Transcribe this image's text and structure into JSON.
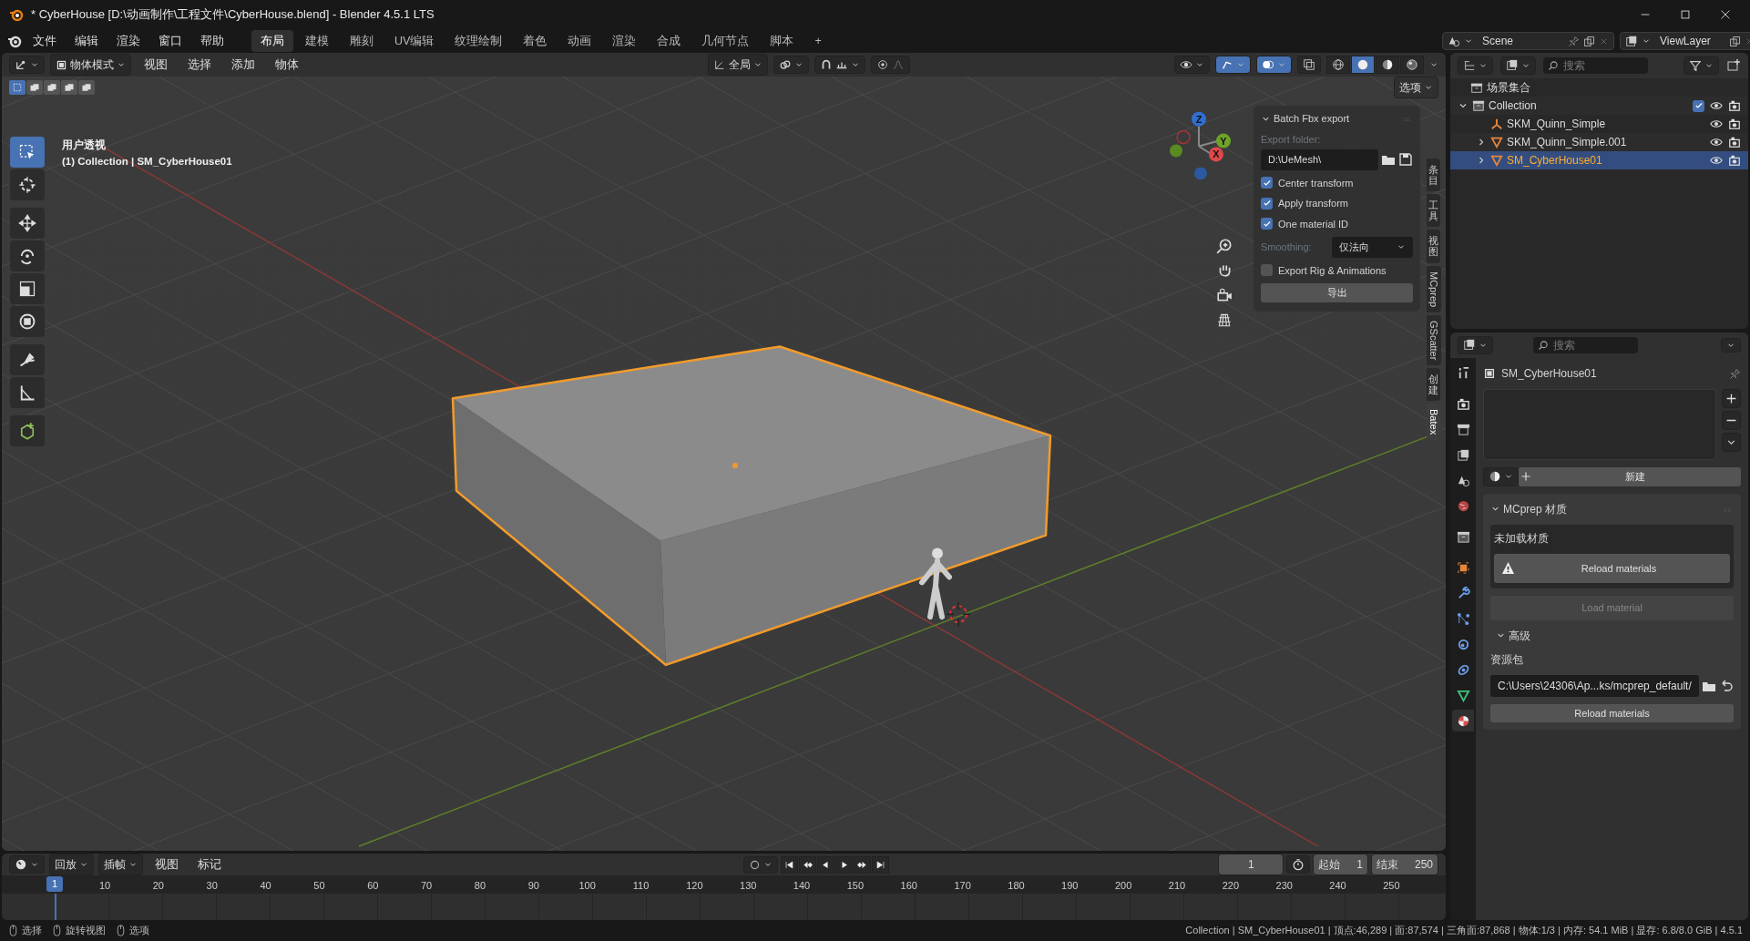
{
  "window": {
    "title": "* CyberHouse [D:\\动画制作\\工程文件\\CyberHouse.blend] - Blender 4.5.1 LTS"
  },
  "menu": [
    "文件",
    "编辑",
    "渲染",
    "窗口",
    "帮助"
  ],
  "workspaces": [
    {
      "label": "布局",
      "selected": true
    },
    {
      "label": "建模",
      "selected": false
    },
    {
      "label": "雕刻",
      "selected": false
    },
    {
      "label": "UV编辑",
      "selected": false
    },
    {
      "label": "纹理绘制",
      "selected": false
    },
    {
      "label": "着色",
      "selected": false
    },
    {
      "label": "动画",
      "selected": false
    },
    {
      "label": "渲染",
      "selected": false
    },
    {
      "label": "合成",
      "selected": false
    },
    {
      "label": "几何节点",
      "selected": false
    },
    {
      "label": "脚本",
      "selected": false
    }
  ],
  "add_workspace": "+",
  "scene": "Scene",
  "view_layer": "ViewLayer",
  "viewport": {
    "mode": "物体模式",
    "menus": [
      "视图",
      "选择",
      "添加",
      "物体"
    ],
    "orientation": "全局",
    "options": "选项",
    "view_name": "用户透视",
    "context": "(1) Collection | SM_CyberHouse01",
    "select_modes": [
      {
        "selected": true
      },
      {
        "selected": false
      },
      {
        "selected": false
      },
      {
        "selected": false
      },
      {
        "selected": false
      }
    ],
    "toggles": [
      {
        "kind": "visibility",
        "on": false
      },
      {
        "kind": "gizmo",
        "on": true
      },
      {
        "kind": "overlay",
        "on": true
      },
      {
        "kind": "xray",
        "on": false
      }
    ],
    "shading": [
      {
        "kind": "wireframe",
        "selected": false
      },
      {
        "kind": "solid",
        "selected": true
      },
      {
        "kind": "material",
        "selected": false
      },
      {
        "kind": "rendered",
        "selected": false
      }
    ],
    "tools": [
      {
        "kind": "select",
        "selected": true
      },
      {
        "kind": "cursor",
        "selected": false
      },
      {
        "kind": "move",
        "selected": false
      },
      {
        "kind": "rotate",
        "selected": false
      },
      {
        "kind": "scale",
        "selected": false
      },
      {
        "kind": "transform",
        "selected": false
      },
      {
        "kind": "annotate",
        "selected": false
      },
      {
        "kind": "measure",
        "selected": false
      },
      {
        "kind": "add",
        "selected": false
      }
    ],
    "gizmo": [
      "Z",
      "Y",
      "X"
    ]
  },
  "sidebar": {
    "title": "Batch Fbx export",
    "folder_label": "Export folder:",
    "folder": "D:\\UeMesh\\",
    "rows": [
      {
        "kind": "checkbox",
        "label": "Center transform",
        "checked": true
      },
      {
        "kind": "checkbox",
        "label": "Apply transform",
        "checked": true
      },
      {
        "kind": "checkbox",
        "label": "One material ID",
        "checked": true
      },
      {
        "kind": "select",
        "label": "Smoothing:",
        "value": "仅法向"
      },
      {
        "kind": "checkbox",
        "label": "Export Rig & Animations",
        "checked": false
      }
    ],
    "export_button": "导出",
    "tabs": [
      {
        "label": "条目",
        "kind": "stacked",
        "selected": false
      },
      {
        "label": "工具",
        "kind": "stacked",
        "selected": false
      },
      {
        "label": "视图",
        "kind": "stacked",
        "selected": false
      },
      {
        "label": "MCprep",
        "kind": "rotated",
        "selected": false
      },
      {
        "label": "GScatter",
        "kind": "rotated",
        "selected": false
      },
      {
        "label": "创建",
        "kind": "stacked",
        "selected": false
      },
      {
        "label": "Batex",
        "kind": "rotated",
        "selected": true
      }
    ]
  },
  "outliner": {
    "search_placeholder": "搜索",
    "root": "场景集合",
    "tree": [
      {
        "label": "Collection",
        "kind": "collection",
        "expanded": true,
        "checked": true,
        "selected": false,
        "children": [
          {
            "label": "SKM_Quinn_Simple",
            "kind": "armature",
            "selected": false
          },
          {
            "label": "SKM_Quinn_Simple.001",
            "kind": "mesh",
            "expanded": false,
            "selected": false
          },
          {
            "label": "SM_CyberHouse01",
            "kind": "mesh",
            "expanded": false,
            "selected": true
          }
        ]
      }
    ]
  },
  "properties": {
    "search_placeholder": "搜索",
    "object_name": "SM_CyberHouse01",
    "tabs": [
      {
        "kind": "tool",
        "selected": false
      },
      {
        "kind": "render",
        "selected": false
      },
      {
        "kind": "output",
        "selected": false
      },
      {
        "kind": "viewlayer",
        "selected": false
      },
      {
        "kind": "scene",
        "selected": false
      },
      {
        "kind": "world",
        "selected": false
      },
      {
        "kind": "collection",
        "selected": false
      },
      {
        "kind": "object",
        "selected": false
      },
      {
        "kind": "modifier",
        "selected": false
      },
      {
        "kind": "particles",
        "selected": false
      },
      {
        "kind": "physics",
        "selected": false
      },
      {
        "kind": "constraint",
        "selected": false
      },
      {
        "kind": "data",
        "selected": false
      },
      {
        "kind": "material",
        "selected": true
      }
    ],
    "new_button": "新建",
    "mcprep": {
      "title": "MCprep 材质",
      "status": "未加载材质",
      "warning_button": "Reload materials",
      "load_button": "Load material",
      "load_disabled": true,
      "advanced": "高级",
      "pack_label": "资源包",
      "pack_path": "C:\\Users\\24306\\Ap...ks/mcprep_default/",
      "reload_button": "Reload materials"
    }
  },
  "timeline": {
    "menus": [
      "回放",
      "插帧",
      "视图",
      "标记"
    ],
    "current_frame": "1",
    "playhead": "1",
    "start_label": "起始",
    "start": "1",
    "end_label": "结束",
    "end": "250",
    "ticks": [
      "10",
      "20",
      "30",
      "40",
      "50",
      "60",
      "70",
      "80",
      "90",
      "100",
      "110",
      "120",
      "130",
      "140",
      "150",
      "160",
      "170",
      "180",
      "190",
      "200",
      "210",
      "220",
      "230",
      "240",
      "250"
    ]
  },
  "status_bar": {
    "hints": [
      "选择",
      "旋转视图",
      "选项"
    ],
    "info": "Collection | SM_CyberHouse01 | 顶点:46,289 | 面:87,574 | 三角面:87,868 | 物体:1/3 | 内存: 54.1 MiB | 显存: 6.8/8.0 GiB | 4.5.1"
  }
}
